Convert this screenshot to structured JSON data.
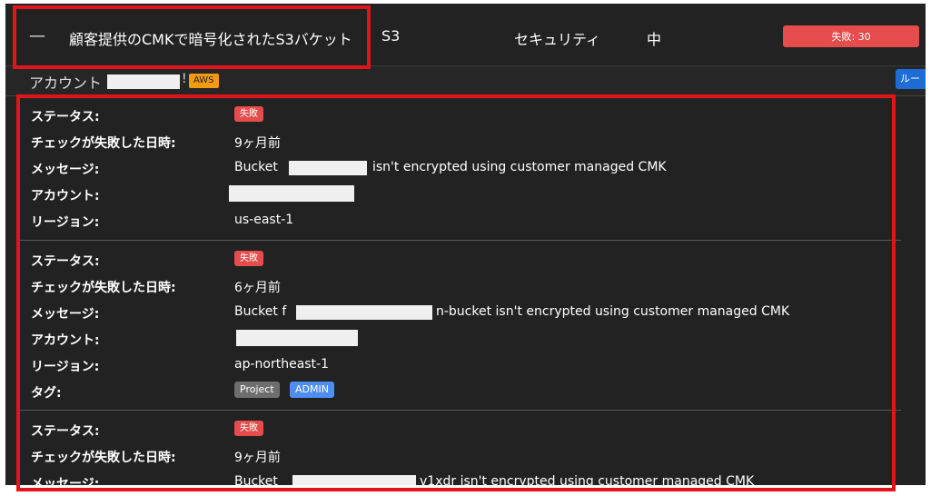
{
  "header": {
    "collapse_symbol": "—",
    "rule_title": "顧客提供のCMKで暗号化されたS3バケット",
    "service": "S3",
    "category": "セキュリティ",
    "severity": "中",
    "fail_count_label": "失敗: 30"
  },
  "account_bar": {
    "label": "アカウント",
    "provider_badge": "AWS",
    "rule_button": "ルー"
  },
  "labels": {
    "status": "ステータス:",
    "failed_at": "チェックが失敗した日時:",
    "message": "メッセージ:",
    "account": "アカウント:",
    "region": "リージョン:",
    "tags": "タグ:"
  },
  "findings": [
    {
      "status": "失敗",
      "failed_at": "9ヶ月前",
      "message_prefix": "Bucket",
      "message_suffix": "isn't encrypted using customer managed CMK",
      "region": "us-east-1"
    },
    {
      "status": "失敗",
      "failed_at": "6ヶ月前",
      "message_prefix": "Bucket f",
      "message_suffix": "n-bucket isn't encrypted using customer managed CMK",
      "region": "ap-northeast-1",
      "tags": [
        "Project",
        "ADMIN"
      ]
    },
    {
      "status": "失敗",
      "failed_at": "9ヶ月前",
      "message_prefix": "Bucket",
      "message_suffix": "v1xdr isn't encrypted using customer managed CMK"
    }
  ],
  "colors": {
    "panel_bg": "#222222",
    "fail_red": "#e74c4c",
    "aws_orange": "#f29b12",
    "admin_blue": "#4d8ef0",
    "highlight_red": "#e2141b"
  }
}
